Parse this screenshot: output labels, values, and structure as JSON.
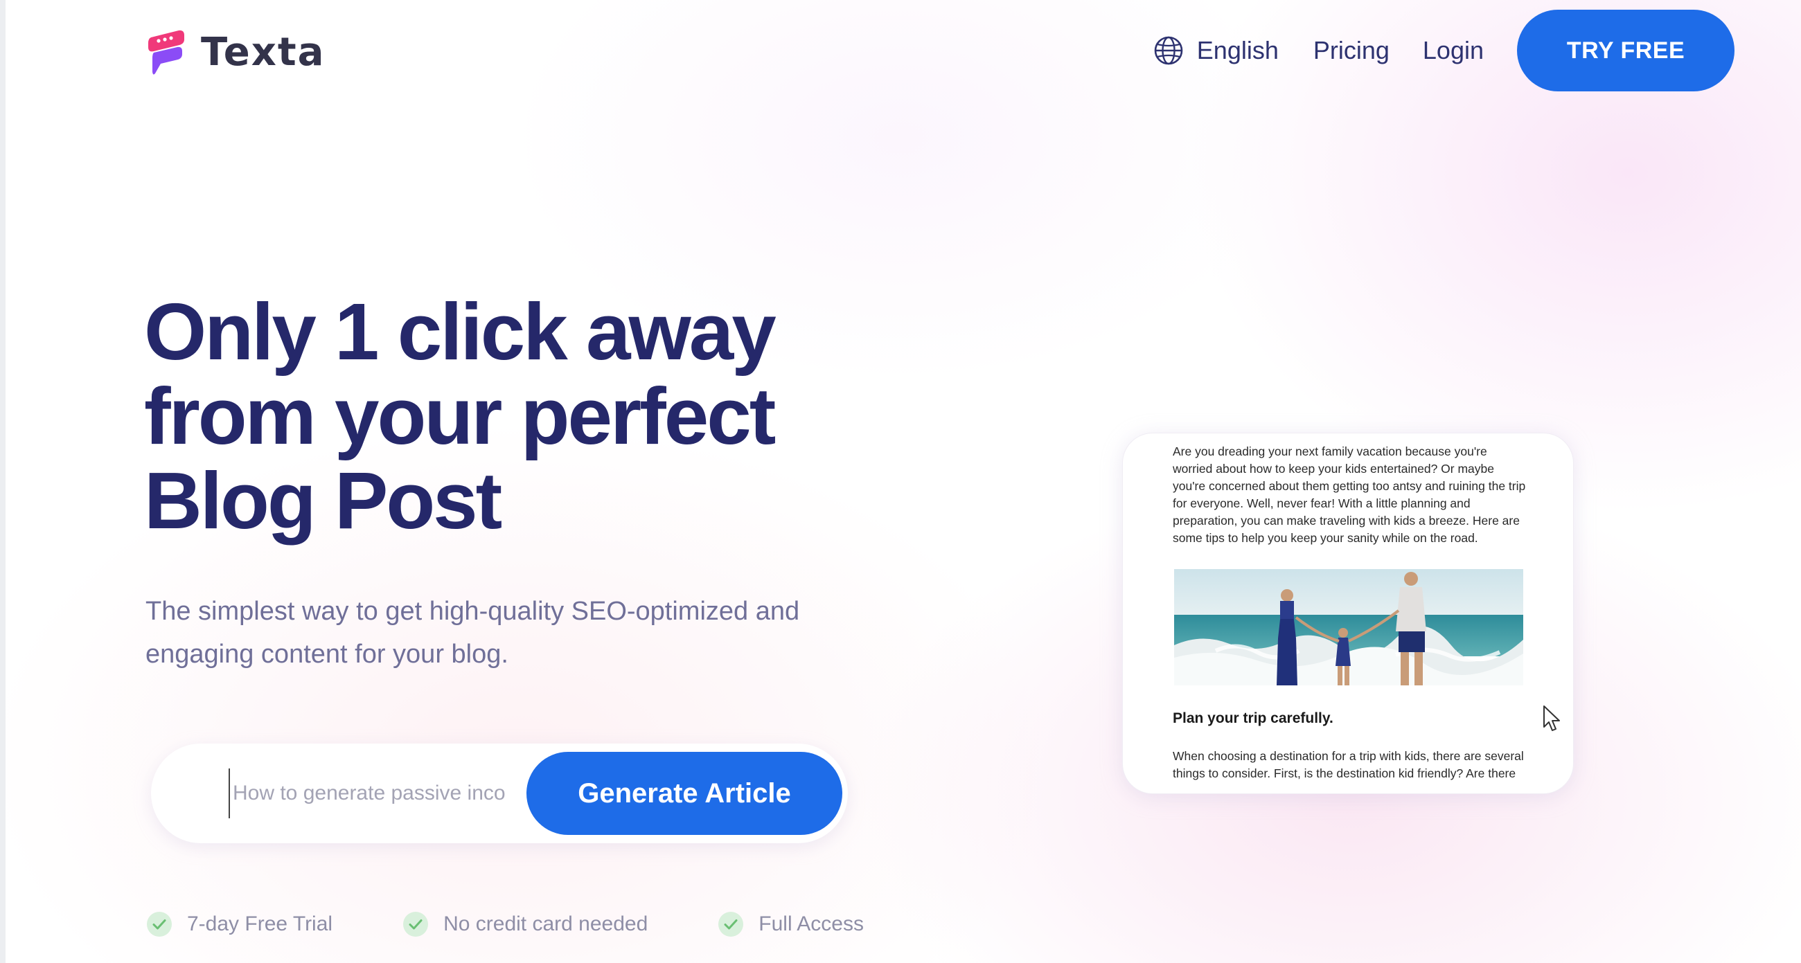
{
  "brand": {
    "name": "Texta",
    "colors": {
      "primary": "#1e6ce8",
      "heading": "#25286a",
      "logo_pink": "#f0397a",
      "logo_purple": "#8b4cf6",
      "check_green": "#6abf73"
    }
  },
  "nav": {
    "language": "English",
    "pricing": "Pricing",
    "login": "Login",
    "cta": "TRY FREE"
  },
  "hero": {
    "title_lines": [
      "Only 1 click away",
      "from your perfect",
      "Blog Post"
    ],
    "subtitle_lines": [
      "The simplest way to get high-quality SEO-optimized and",
      "engaging content for your blog."
    ]
  },
  "generator": {
    "placeholder": "How to generate passive income",
    "button": "Generate Article"
  },
  "features": [
    {
      "label": "7-day Free Trial",
      "icon": "check-icon"
    },
    {
      "label": "No credit card needed",
      "icon": "check-icon"
    },
    {
      "label": "Full Access",
      "icon": "check-icon"
    }
  ],
  "preview": {
    "intro": "Are you dreading your next family vacation because you're worried about how to keep your kids entertained? Or maybe you're concerned about them getting too antsy and ruining the trip for everyone. Well, never fear! With a little planning and preparation, you can make traveling with kids a breeze. Here are some tips to help you keep your sanity while on the road.",
    "heading": "Plan your trip carefully.",
    "body": "When choosing a destination for a trip with kids, there are several things to consider. First, is the destination kid friendly? Are there"
  }
}
